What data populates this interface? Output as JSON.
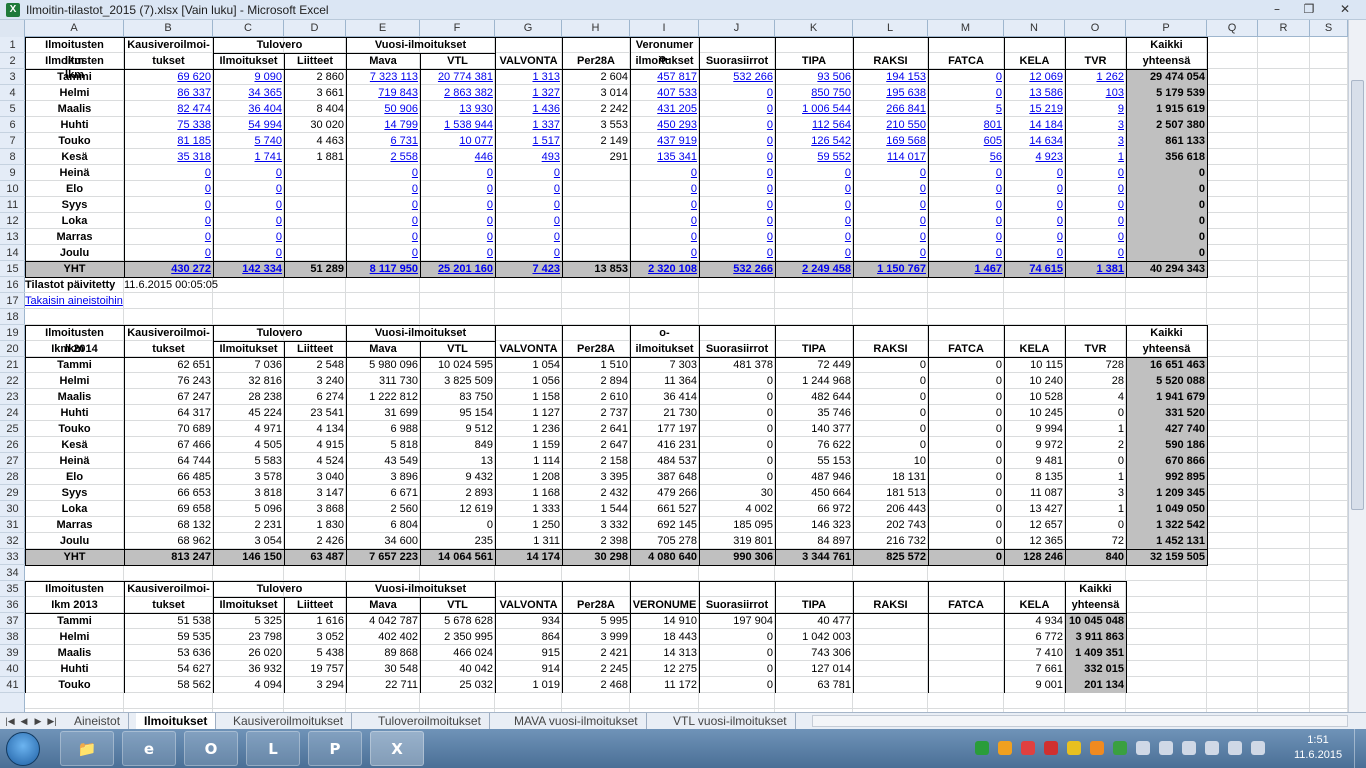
{
  "window": {
    "title": "Ilmoitin-tilastot_2015 (7).xlsx  [Vain luku]  -  Microsoft Excel",
    "app_icon": "X"
  },
  "columns": [
    "A",
    "B",
    "C",
    "D",
    "E",
    "F",
    "G",
    "H",
    "I",
    "J",
    "K",
    "L",
    "M",
    "N",
    "O",
    "P",
    "Q",
    "R",
    "S"
  ],
  "rows": [
    "1",
    "2",
    "3",
    "4",
    "5",
    "6",
    "7",
    "8",
    "9",
    "10",
    "11",
    "12",
    "13",
    "14",
    "15",
    "16",
    "17",
    "18",
    "19",
    "20",
    "21",
    "22",
    "23",
    "24",
    "25",
    "26",
    "27",
    "28",
    "29",
    "30",
    "31",
    "32",
    "33",
    "34",
    "35",
    "36",
    "37",
    "38",
    "39",
    "40",
    "41"
  ],
  "t1": {
    "h_ilm": "Ilmoitusten",
    "h_lkm": "lkm",
    "h_kv1": "Kausiveroilmoi-",
    "h_kv2": "tukset",
    "h_tv": "Tulovero",
    "h_ilmoitukset": "Ilmoitukset",
    "h_liitteet": "Liitteet",
    "h_vuosi": "Vuosi-ilmoitukset",
    "h_mava": "Mava",
    "h_vtl": "VTL",
    "h_valvonta": "VALVONTA",
    "h_per": "Per28A",
    "h_vn1": "Veronumer",
    "h_vn2": "o-",
    "h_vn3": "ilmoitukset",
    "h_suora": "Suorasiirrot",
    "h_tipa": "TIPA",
    "h_raksi": "RAKSI",
    "h_fatca": "FATCA",
    "h_kela": "KELA",
    "h_tvr": "TVR",
    "h_kaikki1": "Kaikki",
    "h_kaikki2": "yhteensä",
    "data": [
      [
        "Tammi",
        "69 620",
        "9 090",
        "2 860",
        "7 323 113",
        "20 774 381",
        "1 313",
        "2 604",
        "457 817",
        "532 266",
        "93 506",
        "194 153",
        "0",
        "12 069",
        "1 262",
        "29 474 054"
      ],
      [
        "Helmi",
        "86 337",
        "34 365",
        "3 661",
        "719 843",
        "2 863 382",
        "1 327",
        "3 014",
        "407 533",
        "0",
        "850 750",
        "195 638",
        "0",
        "13 586",
        "103",
        "5 179 539"
      ],
      [
        "Maalis",
        "82 474",
        "36 404",
        "8 404",
        "50 906",
        "13 930",
        "1 436",
        "2 242",
        "431 205",
        "0",
        "1 006 544",
        "266 841",
        "5",
        "15 219",
        "9",
        "1 915 619"
      ],
      [
        "Huhti",
        "75 338",
        "54 994",
        "30 020",
        "14 799",
        "1 538 944",
        "1 337",
        "3 553",
        "450 293",
        "0",
        "112 564",
        "210 550",
        "801",
        "14 184",
        "3",
        "2 507 380"
      ],
      [
        "Touko",
        "81 185",
        "5 740",
        "4 463",
        "6 731",
        "10 077",
        "1 517",
        "2 149",
        "437 919",
        "0",
        "126 542",
        "169 568",
        "605",
        "14 634",
        "3",
        "861 133"
      ],
      [
        "Kesä",
        "35 318",
        "1 741",
        "1 881",
        "2 558",
        "446",
        "493",
        "291",
        "135 341",
        "0",
        "59 552",
        "114 017",
        "56",
        "4 923",
        "1",
        "356 618"
      ],
      [
        "Heinä",
        "0",
        "0",
        "",
        "0",
        "0",
        "0",
        "",
        "0",
        "0",
        "0",
        "0",
        "0",
        "0",
        "0",
        "0"
      ],
      [
        "Elo",
        "0",
        "0",
        "",
        "0",
        "0",
        "0",
        "",
        "0",
        "0",
        "0",
        "0",
        "0",
        "0",
        "0",
        "0"
      ],
      [
        "Syys",
        "0",
        "0",
        "",
        "0",
        "0",
        "0",
        "",
        "0",
        "0",
        "0",
        "0",
        "0",
        "0",
        "0",
        "0"
      ],
      [
        "Loka",
        "0",
        "0",
        "",
        "0",
        "0",
        "0",
        "",
        "0",
        "0",
        "0",
        "0",
        "0",
        "0",
        "0",
        "0"
      ],
      [
        "Marras",
        "0",
        "0",
        "",
        "0",
        "0",
        "0",
        "",
        "0",
        "0",
        "0",
        "0",
        "0",
        "0",
        "0",
        "0"
      ],
      [
        "Joulu",
        "0",
        "0",
        "",
        "0",
        "0",
        "0",
        "",
        "0",
        "0",
        "0",
        "0",
        "0",
        "0",
        "0",
        "0"
      ],
      [
        "YHT",
        "430 272",
        "142 334",
        "51 289",
        "8 117 950",
        "25 201 160",
        "7 423",
        "13 853",
        "2 320 108",
        "532 266",
        "2 249 458",
        "1 150 767",
        "1 467",
        "74 615",
        "1 381",
        "40 294 343"
      ]
    ]
  },
  "info": {
    "label": "Tilastot päivitetty",
    "value": "11.6.2015 00:05:05",
    "link": "Takaisin aineistoihin"
  },
  "t2": {
    "h_lkm": "Ikm 2014",
    "h_vn": "o-",
    "h_vn3": "ilmoitukset",
    "data": [
      [
        "Tammi",
        "62 651",
        "7 036",
        "2 548",
        "5 980 096",
        "10 024 595",
        "1 054",
        "1 510",
        "7 303",
        "481 378",
        "72 449",
        "0",
        "0",
        "10 115",
        "728",
        "16 651 463"
      ],
      [
        "Helmi",
        "76 243",
        "32 816",
        "3 240",
        "311 730",
        "3 825 509",
        "1 056",
        "2 894",
        "11 364",
        "0",
        "1 244 968",
        "0",
        "0",
        "10 240",
        "28",
        "5 520 088"
      ],
      [
        "Maalis",
        "67 247",
        "28 238",
        "6 274",
        "1 222 812",
        "83 750",
        "1 158",
        "2 610",
        "36 414",
        "0",
        "482 644",
        "0",
        "0",
        "10 528",
        "4",
        "1 941 679"
      ],
      [
        "Huhti",
        "64 317",
        "45 224",
        "23 541",
        "31 699",
        "95 154",
        "1 127",
        "2 737",
        "21 730",
        "0",
        "35 746",
        "0",
        "0",
        "10 245",
        "0",
        "331 520"
      ],
      [
        "Touko",
        "70 689",
        "4 971",
        "4 134",
        "6 988",
        "9 512",
        "1 236",
        "2 641",
        "177 197",
        "0",
        "140 377",
        "0",
        "0",
        "9 994",
        "1",
        "427 740"
      ],
      [
        "Kesä",
        "67 466",
        "4 505",
        "4 915",
        "5 818",
        "849",
        "1 159",
        "2 647",
        "416 231",
        "0",
        "76 622",
        "0",
        "0",
        "9 972",
        "2",
        "590 186"
      ],
      [
        "Heinä",
        "64 744",
        "5 583",
        "4 524",
        "43 549",
        "13",
        "1 114",
        "2 158",
        "484 537",
        "0",
        "55 153",
        "10",
        "0",
        "9 481",
        "0",
        "670 866"
      ],
      [
        "Elo",
        "66 485",
        "3 578",
        "3 040",
        "3 896",
        "9 432",
        "1 208",
        "3 395",
        "387 648",
        "0",
        "487 946",
        "18 131",
        "0",
        "8 135",
        "1",
        "992 895"
      ],
      [
        "Syys",
        "66 653",
        "3 818",
        "3 147",
        "6 671",
        "2 893",
        "1 168",
        "2 432",
        "479 266",
        "30",
        "450 664",
        "181 513",
        "0",
        "11 087",
        "3",
        "1 209 345"
      ],
      [
        "Loka",
        "69 658",
        "5 096",
        "3 868",
        "2 560",
        "12 619",
        "1 333",
        "1 544",
        "661 527",
        "4 002",
        "66 972",
        "206 443",
        "0",
        "13 427",
        "1",
        "1 049 050"
      ],
      [
        "Marras",
        "68 132",
        "2 231",
        "1 830",
        "6 804",
        "0",
        "1 250",
        "3 332",
        "692 145",
        "185 095",
        "146 323",
        "202 743",
        "0",
        "12 657",
        "0",
        "1 322 542"
      ],
      [
        "Joulu",
        "68 962",
        "3 054",
        "2 426",
        "34 600",
        "235",
        "1 311",
        "2 398",
        "705 278",
        "319 801",
        "84 897",
        "216 732",
        "0",
        "12 365",
        "72",
        "1 452 131"
      ],
      [
        "YHT",
        "813 247",
        "146 150",
        "63 487",
        "7 657 223",
        "14 064 561",
        "14 174",
        "30 298",
        "4 080 640",
        "990 306",
        "3 344 761",
        "825 572",
        "0",
        "128 246",
        "840",
        "32 159 505"
      ]
    ]
  },
  "t3": {
    "h_lkm": "Ikm 2013",
    "h_kv1": "Kausiveroilmoi-",
    "h_vn": "VERONUME",
    "data": [
      [
        "Tammi",
        "51 538",
        "5 325",
        "1 616",
        "4 042 787",
        "5 678 628",
        "934",
        "5 995",
        "14 910",
        "197 904",
        "40 477",
        "",
        "",
        "4 934",
        "10 045 048"
      ],
      [
        "Helmi",
        "59 535",
        "23 798",
        "3 052",
        "402 402",
        "2 350 995",
        "864",
        "3 999",
        "18 443",
        "0",
        "1 042 003",
        "",
        "",
        "6 772",
        "3 911 863"
      ],
      [
        "Maalis",
        "53 636",
        "26 020",
        "5 438",
        "89 868",
        "466 024",
        "915",
        "2 421",
        "14 313",
        "0",
        "743 306",
        "",
        "",
        "7 410",
        "1 409 351"
      ],
      [
        "Huhti",
        "54 627",
        "36 932",
        "19 757",
        "30 548",
        "40 042",
        "914",
        "2 245",
        "12 275",
        "0",
        "127 014",
        "",
        "",
        "7 661",
        "332 015"
      ],
      [
        "Touko",
        "58 562",
        "4 094",
        "3 294",
        "22 711",
        "25 032",
        "1 019",
        "2 468",
        "11 172",
        "0",
        "63 781",
        "",
        "",
        "9 001",
        "201 134"
      ]
    ]
  },
  "tabs": [
    "Aineistot",
    "Ilmoitukset",
    "Kausiveroilmoitukset",
    "Tuloveroilmoitukset",
    "MAVA vuosi-ilmoitukset",
    "VTL vuosi-ilmoitukset"
  ],
  "active_tab": "Ilmoitukset",
  "clock": {
    "time": "1:51",
    "date": "11.6.2015"
  },
  "colors": {
    "link": "#0000ee",
    "total": "#c0c0c0",
    "header": "#e4ecf7"
  }
}
